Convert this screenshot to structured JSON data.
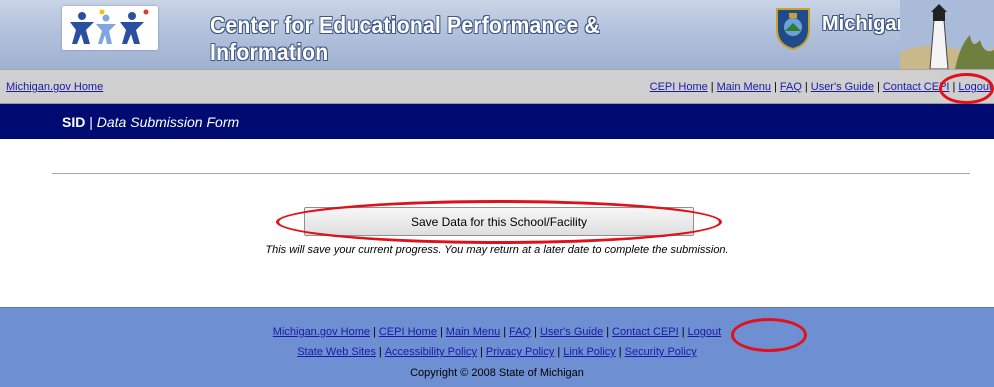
{
  "banner": {
    "title": "Center for Educational Performance & Information",
    "state_logo_text": "Michigan.gov",
    "logo_icon": "children-logo-icon",
    "seal_icon": "michigan-seal-icon",
    "lighthouse_icon": "lighthouse-icon"
  },
  "utility_nav": {
    "home_link": "Michigan.gov Home",
    "links": [
      "CEPI Home",
      "Main Menu",
      "FAQ",
      "User's Guide",
      "Contact CEPI",
      "Logout"
    ],
    "separator": "|"
  },
  "title_bar": {
    "system": "SID",
    "separator": "|",
    "page": "Data Submission Form"
  },
  "form": {
    "save_button_label": "Save Data for this School/Facility",
    "save_note": "This will save your current progress. You may return at a later date to complete the submission."
  },
  "footer": {
    "row1_links": [
      "Michigan.gov Home",
      "CEPI Home",
      "Main Menu",
      "FAQ",
      "User's Guide",
      "Contact CEPI",
      "Logout"
    ],
    "row2_links": [
      "State Web Sites",
      "Accessibility Policy",
      "Privacy Policy",
      "Link Policy",
      "Security Policy"
    ],
    "copyright": "Copyright © 2008 State of Michigan"
  },
  "colors": {
    "banner": "#b3c2dc",
    "title_bar": "#000b72",
    "footer": "#6f8fd3",
    "highlight_ring": "#e0111b"
  }
}
